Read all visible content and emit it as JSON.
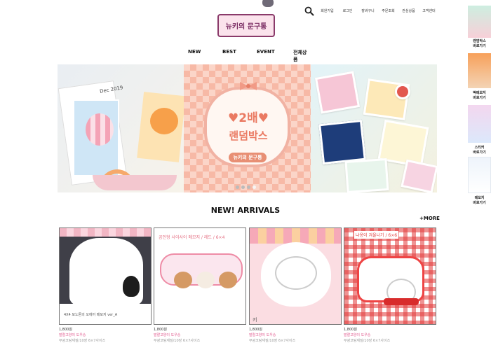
{
  "header": {
    "logo_text": "뉴키의 문구통",
    "util_menu": [
      "회원가입",
      "로그인",
      "장바구니",
      "주문조회",
      "관심상품",
      "고객센터"
    ]
  },
  "nav": [
    "NEW",
    "BEST",
    "EVENT",
    "전체상품"
  ],
  "banner": {
    "left_date": "Dec 2019",
    "headline": "♥2배♥",
    "subhead": "랜덤박스",
    "badge": "뉴키의 문구통",
    "slide_count": 4,
    "active_slide": 4
  },
  "arrivals": {
    "title": "NEW! ARRIVALS",
    "more": "+MORE",
    "products": [
      {
        "thumb_text": "4X4 모노톤의 오에어 메모지 ver_A",
        "price": "1,800원",
        "brand": "발랄고양이 도우숑",
        "desc": "무광코팅재질/10장 6×7사이즈"
      },
      {
        "thumb_text": "곰인형 사이사이 메모지 / 레드 / 6×4",
        "price": "1,800원",
        "brand": "발랄고양이 도우숑",
        "desc": "무광코팅재질/10장 6×7사이즈"
      },
      {
        "thumb_text": "키",
        "price": "1,800원",
        "brand": "발랄고양이 도우숑",
        "desc": "무광코팅재질/10장 6×7사이즈"
      },
      {
        "thumb_text": "냐옹이 겨울나기 / 6×6",
        "price": "1,800원",
        "brand": "발랄고양이 도우숑",
        "desc": "무광코팅재질/10장 6×7사이즈"
      }
    ]
  },
  "sidebar": [
    {
      "label_line1": "랜덤박스",
      "label_line2": "바로가기"
    },
    {
      "label_line1": "떡메모지",
      "label_line2": "바로가기"
    },
    {
      "label_line1": "스티커",
      "label_line2": "바로가기"
    },
    {
      "label_line1": "메모지",
      "label_line2": "바로가기"
    }
  ]
}
